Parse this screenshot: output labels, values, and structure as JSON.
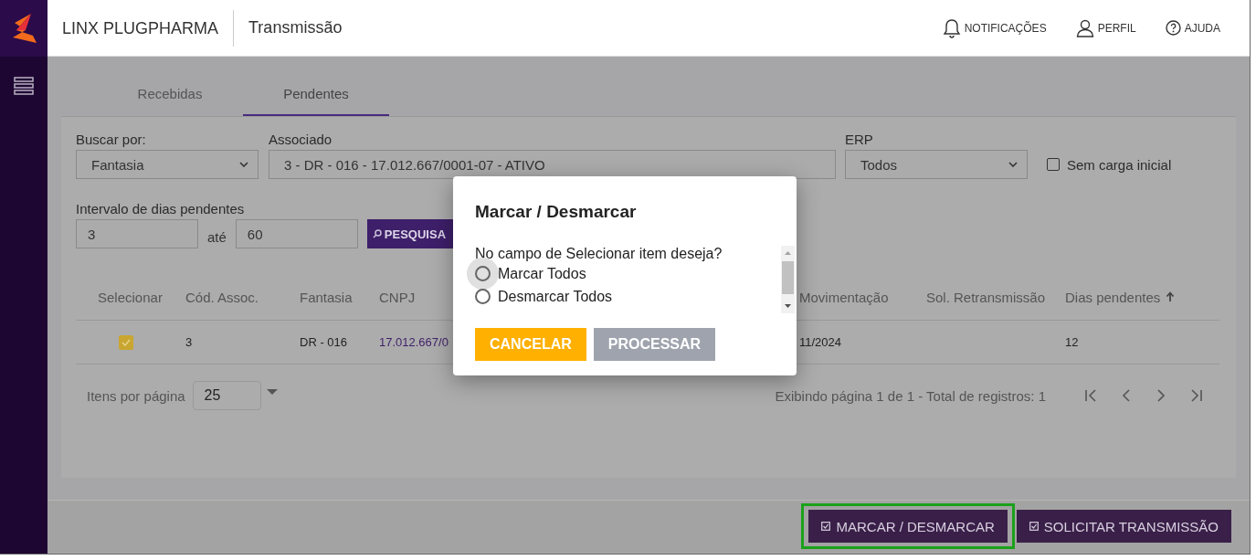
{
  "header": {
    "brand": "LINX PLUGPHARMA",
    "page_title": "Transmissão",
    "actions": [
      {
        "kind": "bell",
        "label": "NOTIFICAÇÕES"
      },
      {
        "kind": "user",
        "label": "PERFIL"
      },
      {
        "kind": "help",
        "label": "AJUDA"
      }
    ]
  },
  "tabs": [
    {
      "label": "Recebidas",
      "selected": false
    },
    {
      "label": "Pendentes",
      "selected": true
    }
  ],
  "filters": {
    "search_by": {
      "label": "Buscar por:",
      "value": "Fantasia"
    },
    "associate": {
      "label": "Associado",
      "value": "3 - DR - 016 - 17.012.667/0001-07 - ATIVO"
    },
    "erp": {
      "label": "ERP",
      "value": "Todos"
    },
    "no_initial_load": {
      "label": "Sem carga inicial",
      "checked": false
    },
    "interval": {
      "label": "Intervalo de dias pendentes",
      "from": "3",
      "separator": "até",
      "to": "60"
    },
    "search_button": "PESQUISA"
  },
  "table": {
    "columns": [
      {
        "label": "Selecionar",
        "sorted": false
      },
      {
        "label": "Cód. Assoc.",
        "sorted": false
      },
      {
        "label": "Fantasia",
        "sorted": false
      },
      {
        "label": "CNPJ",
        "sorted": false
      },
      {
        "label": "Movimentação",
        "sorted": false
      },
      {
        "label": "Sol. Retransmissão",
        "sorted": false
      },
      {
        "label": "Dias pendentes",
        "sorted": true
      }
    ],
    "rows": [
      {
        "checked": true,
        "code": "3",
        "fantasia": "DR - 016",
        "cnpj": "17.012.667/0",
        "movement": "11/2024",
        "pending_days": "12"
      }
    ]
  },
  "pagination": {
    "per_page_label": "Itens por página",
    "per_page": "25",
    "summary": "Exibindo página 1 de 1 - Total de registros: 1"
  },
  "modal": {
    "title": "Marcar / Desmarcar",
    "question": "No campo de Selecionar item deseja?",
    "options": [
      {
        "label": "Marcar Todos",
        "selected": false,
        "hovered": true
      },
      {
        "label": "Desmarcar Todos",
        "selected": false,
        "hovered": false
      }
    ],
    "buttons": [
      {
        "kind": "cancel",
        "label": "CANCELAR"
      },
      {
        "kind": "process",
        "label": "PROCESSAR"
      }
    ]
  },
  "footer_buttons": [
    {
      "label": "MARCAR / DESMARCAR",
      "highlighted": true
    },
    {
      "label": "SOLICITAR TRANSMISSÃO",
      "highlighted": false
    }
  ]
}
